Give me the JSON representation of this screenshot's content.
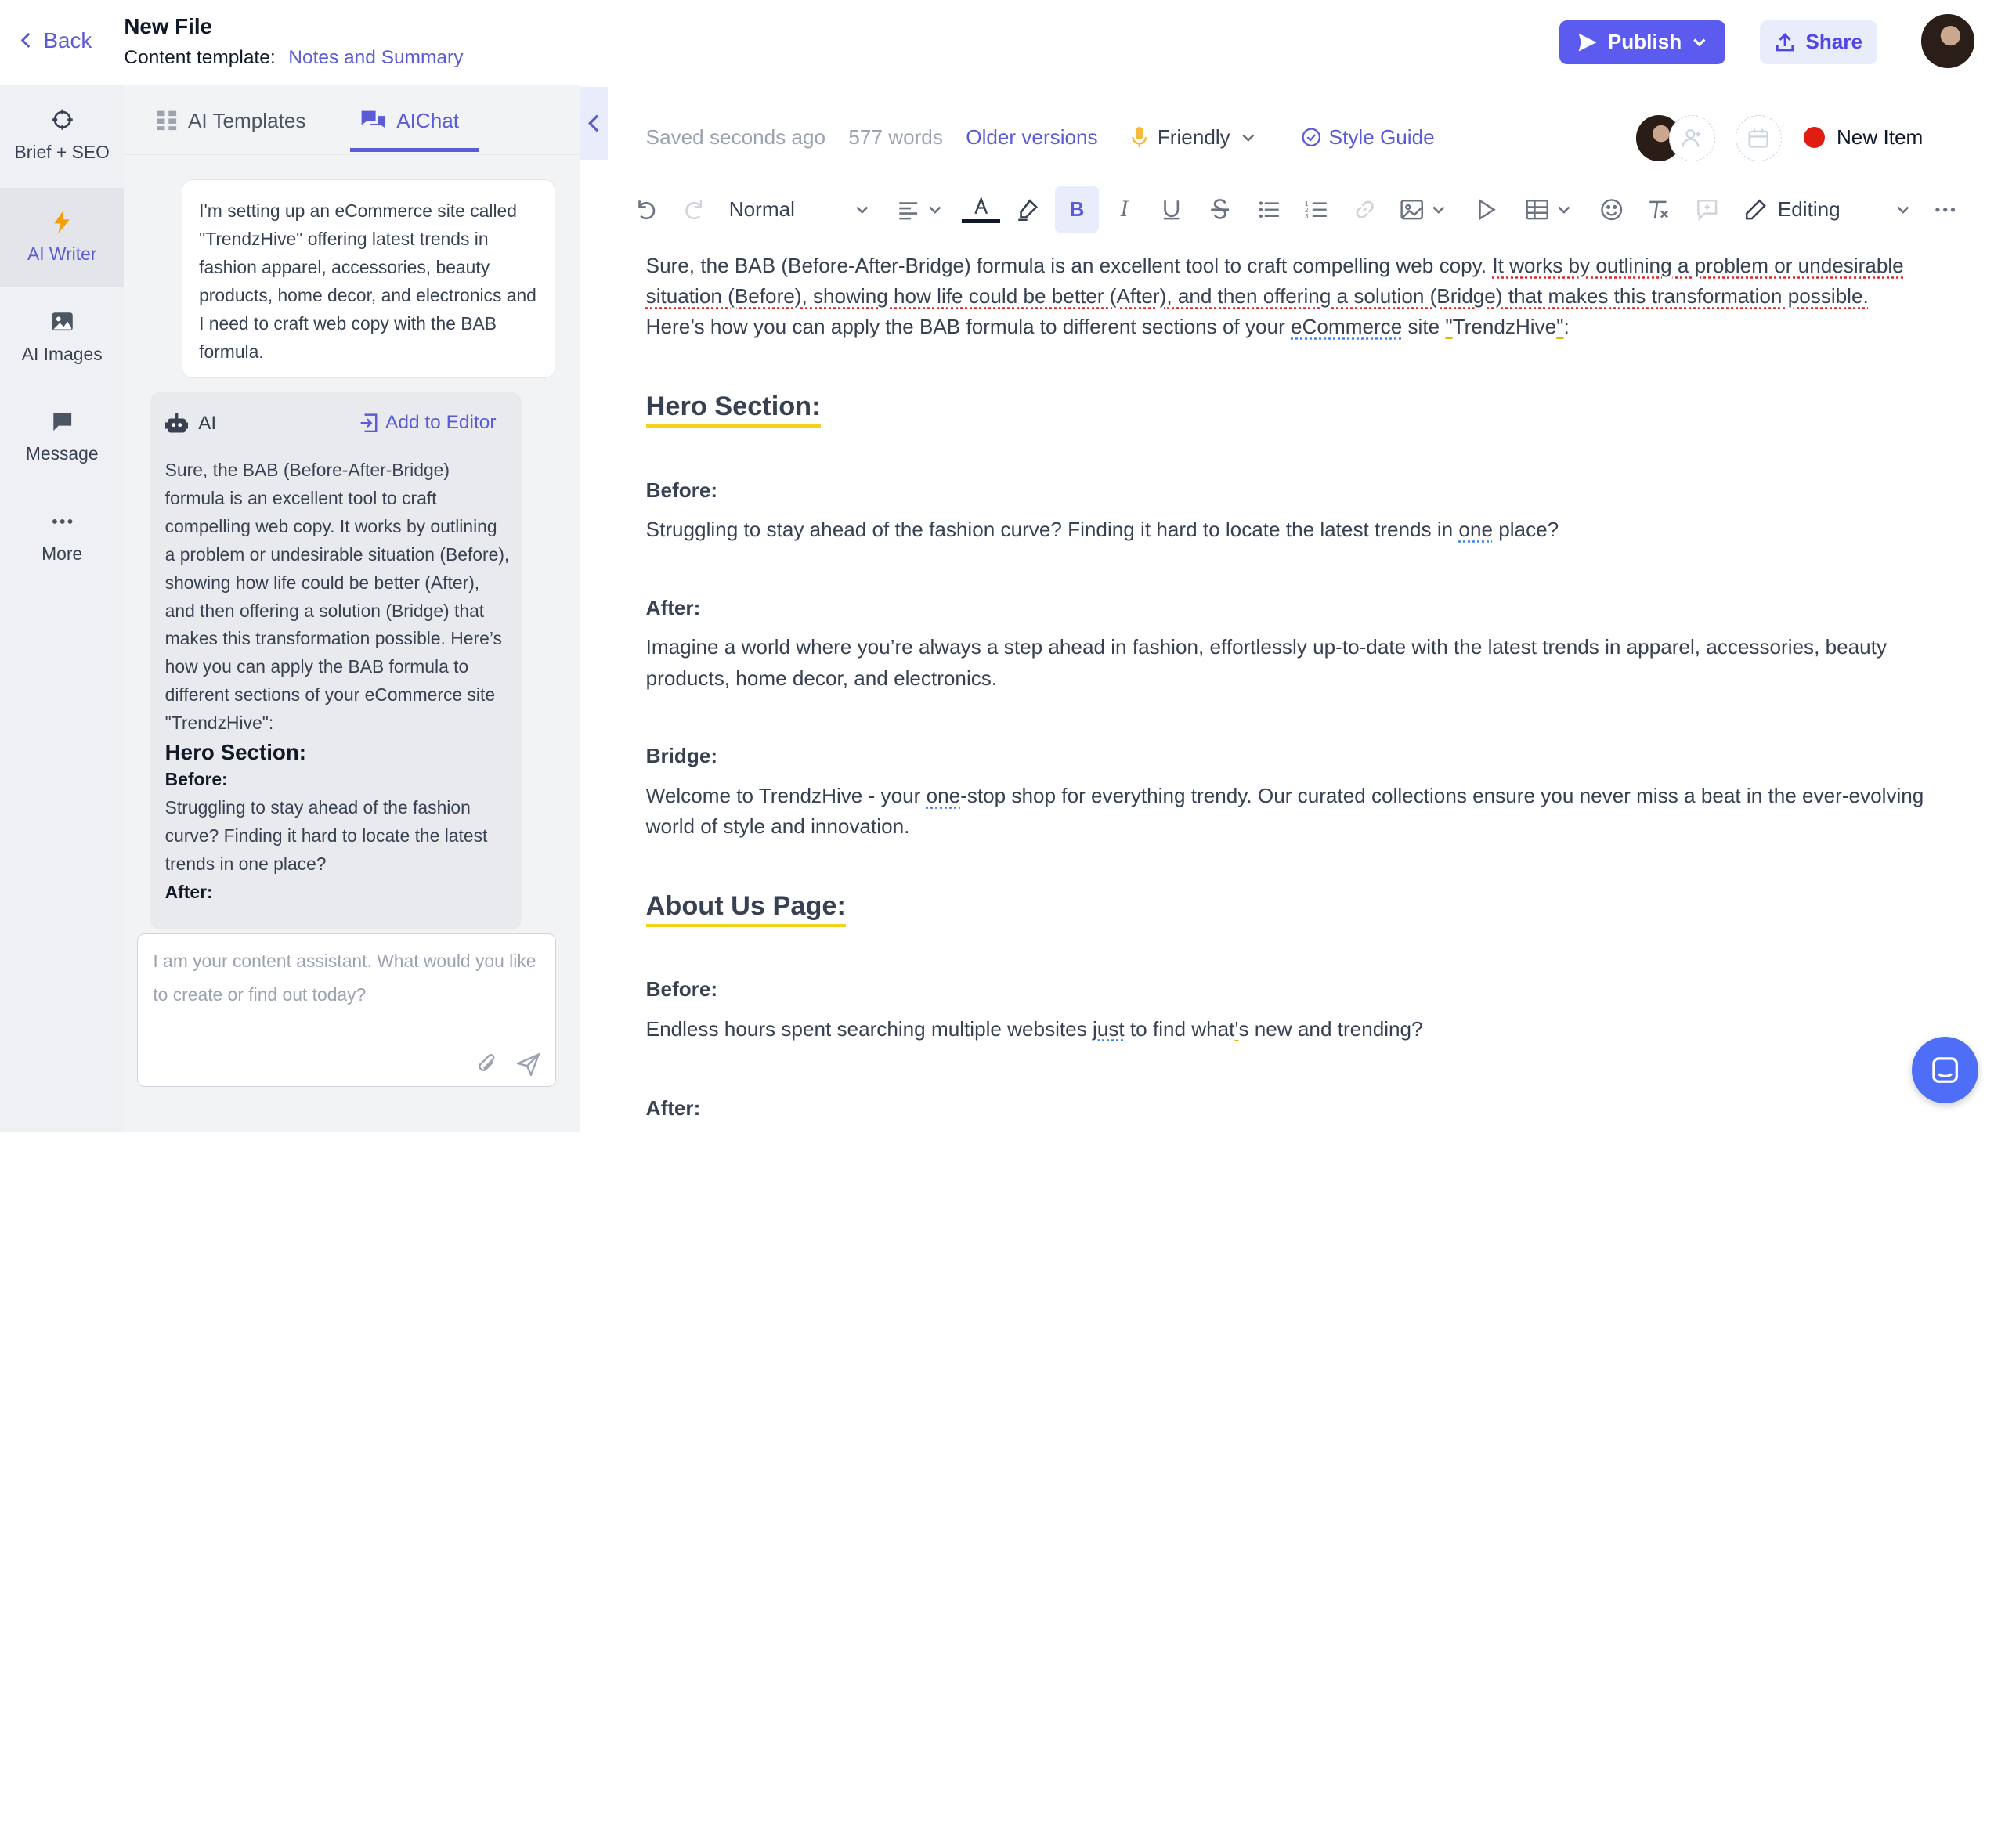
{
  "header": {
    "back_label": "Back",
    "title": "New File",
    "template_label": "Content template:",
    "template_value": "Notes and Summary",
    "publish_label": "Publish",
    "share_label": "Share"
  },
  "rail": {
    "items": [
      {
        "label": "Brief + SEO",
        "icon": "crosshair-icon"
      },
      {
        "label": "AI Writer",
        "icon": "lightning-icon"
      },
      {
        "label": "AI Images",
        "icon": "image-icon"
      },
      {
        "label": "Message",
        "icon": "message-icon"
      },
      {
        "label": "More",
        "icon": "more-icon"
      }
    ],
    "active": "AI Writer"
  },
  "chat": {
    "tabs": [
      "AI Templates",
      "AIChat"
    ],
    "active_tab": "AIChat",
    "user_message": "I'm setting up an eCommerce site called \"TrendzHive\" offering  latest trends in fashion apparel, accessories, beauty products, home decor, and electronics and I need to craft web copy with the BAB formula.",
    "ai_label": "AI",
    "add_to_editor": "Add to Editor",
    "ai_intro": "Sure, the BAB (Before-After-Bridge) formula is an excellent tool to craft compelling web copy. It works by outlining a problem or undesirable situation (Before), showing how life could be better (After), and then offering a solution (Bridge) that makes this transformation possible. Here’s how you can apply the BAB formula to different sections of your eCommerce site \"TrendzHive\":",
    "ai_heading": "Hero Section:",
    "ai_before_label": "Before:",
    "ai_before_text": "Struggling to stay ahead of the fashion curve? Finding it hard to locate the latest trends in one place?",
    "ai_after_label": "After:",
    "input_placeholder": "I am your content assistant. What would you like to create or find out today?"
  },
  "editor": {
    "saved": "Saved seconds ago",
    "words": "577 words",
    "older_versions": "Older versions",
    "tone": "Friendly",
    "style_guide": "Style Guide",
    "new_item": "New Item",
    "block_style": "Normal",
    "mode": "Editing"
  },
  "doc": {
    "intro_a": "Sure, the BAB (Before-After-Bridge) formula is an excellent tool to craft compelling web copy. ",
    "intro_err": "It works by outlining a problem or undesirable situation (Before), showing how life could be better (After), and then offering a solution (Bridge) that makes this transformation possible.",
    "intro_b": " Here’s how you can apply the BAB formula to different sections of your ",
    "intro_sp": "eCommerce",
    "intro_c": " site ",
    "intro_q1": "\"",
    "intro_name": "TrendzHive",
    "intro_q2": "\"",
    "intro_end": ":",
    "hero_heading": "Hero Section:",
    "hero_before_label": "Before:",
    "hero_before_a": "Struggling to stay ahead of the fashion curve? Finding it hard to locate the latest trends in ",
    "hero_before_sp": "one",
    "hero_before_b": " place?",
    "hero_after_label": "After:",
    "hero_after_text": "Imagine a world where you’re always a step ahead in fashion, effortlessly up-to-date with the latest trends in apparel, accessories, beauty products, home decor, and electronics.",
    "hero_bridge_label": "Bridge:",
    "hero_bridge_a": "Welcome to TrendzHive - your ",
    "hero_bridge_sp": "one",
    "hero_bridge_b": "-stop shop for everything trendy. Our curated collections ensure you never miss a beat in the ever-evolving world of style and innovation.",
    "about_heading": "About Us Page:",
    "about_before_label": "Before:",
    "about_before_a": "Endless hours spent searching multiple websites ",
    "about_before_sp": "just",
    "about_before_b": " to find what",
    "about_before_ap": "'",
    "about_before_c": "s new and trending?",
    "about_after_label": "After:"
  },
  "colors": {
    "accent": "#5b5bd6",
    "publish": "#5b5bf0",
    "new_item_dot": "#e11d12",
    "heading_underline": "#f3d21e"
  }
}
